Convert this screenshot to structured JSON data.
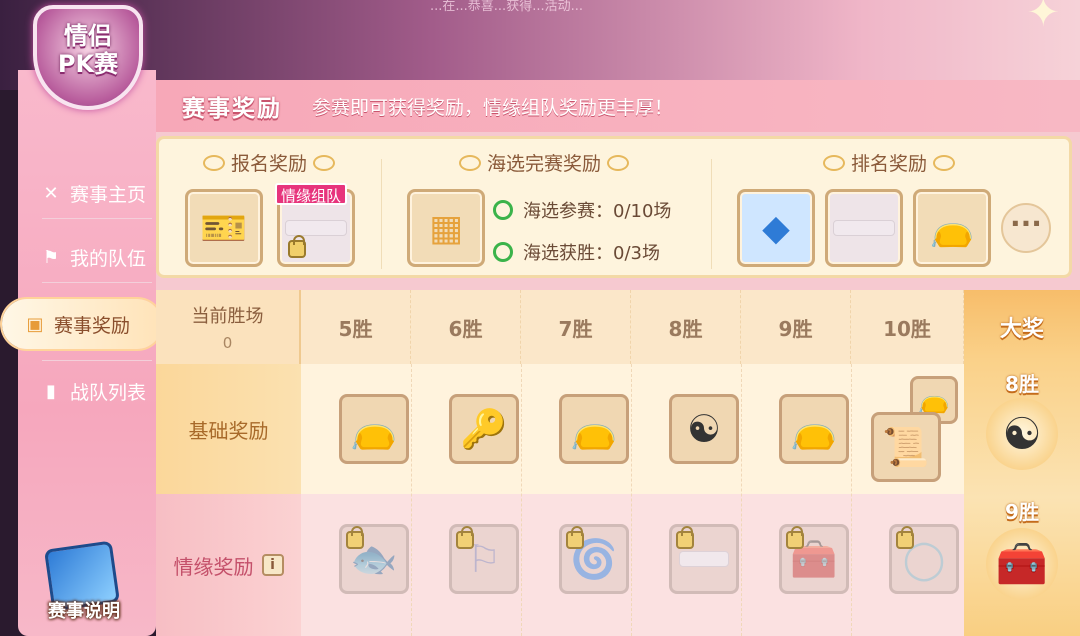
{
  "top": {
    "marquee": "...在...恭喜...获得...活动..."
  },
  "logo": {
    "line1": "情侣",
    "line2": "PK赛"
  },
  "nav": [
    {
      "label": "赛事主页",
      "icon": "x-icon"
    },
    {
      "label": "我的队伍",
      "icon": "flag-icon"
    },
    {
      "label": "赛事奖励",
      "icon": "gift-icon"
    },
    {
      "label": "战队列表",
      "icon": "bar-chart-icon"
    }
  ],
  "help_button": {
    "label": "赛事说明"
  },
  "header": {
    "title": "赛事奖励",
    "subtitle": "参赛即可获得奖励，情缘组队奖励更丰厚！"
  },
  "signup": {
    "title": "报名奖励",
    "tag": "情缘组队"
  },
  "audition": {
    "title": "海选完赛奖励",
    "conditions": [
      "海选参赛：0/10场",
      "海选获胜：0/3场"
    ]
  },
  "ranking": {
    "title": "排名奖励",
    "more": "···"
  },
  "table": {
    "current_label": "当前胜场",
    "current_value": "0",
    "columns": [
      "5胜",
      "6胜",
      "7胜",
      "8胜",
      "9胜",
      "10胜"
    ],
    "grand": {
      "label": "大奖",
      "base_wins": "8胜",
      "love_wins": "9胜"
    },
    "rows": {
      "base": "基础奖励",
      "love": "情缘奖励",
      "love_info": "i"
    }
  },
  "colors": {
    "accent_pink": "#e7347c",
    "panel": "#f6c9d0",
    "gold": "#f7bd6a"
  }
}
